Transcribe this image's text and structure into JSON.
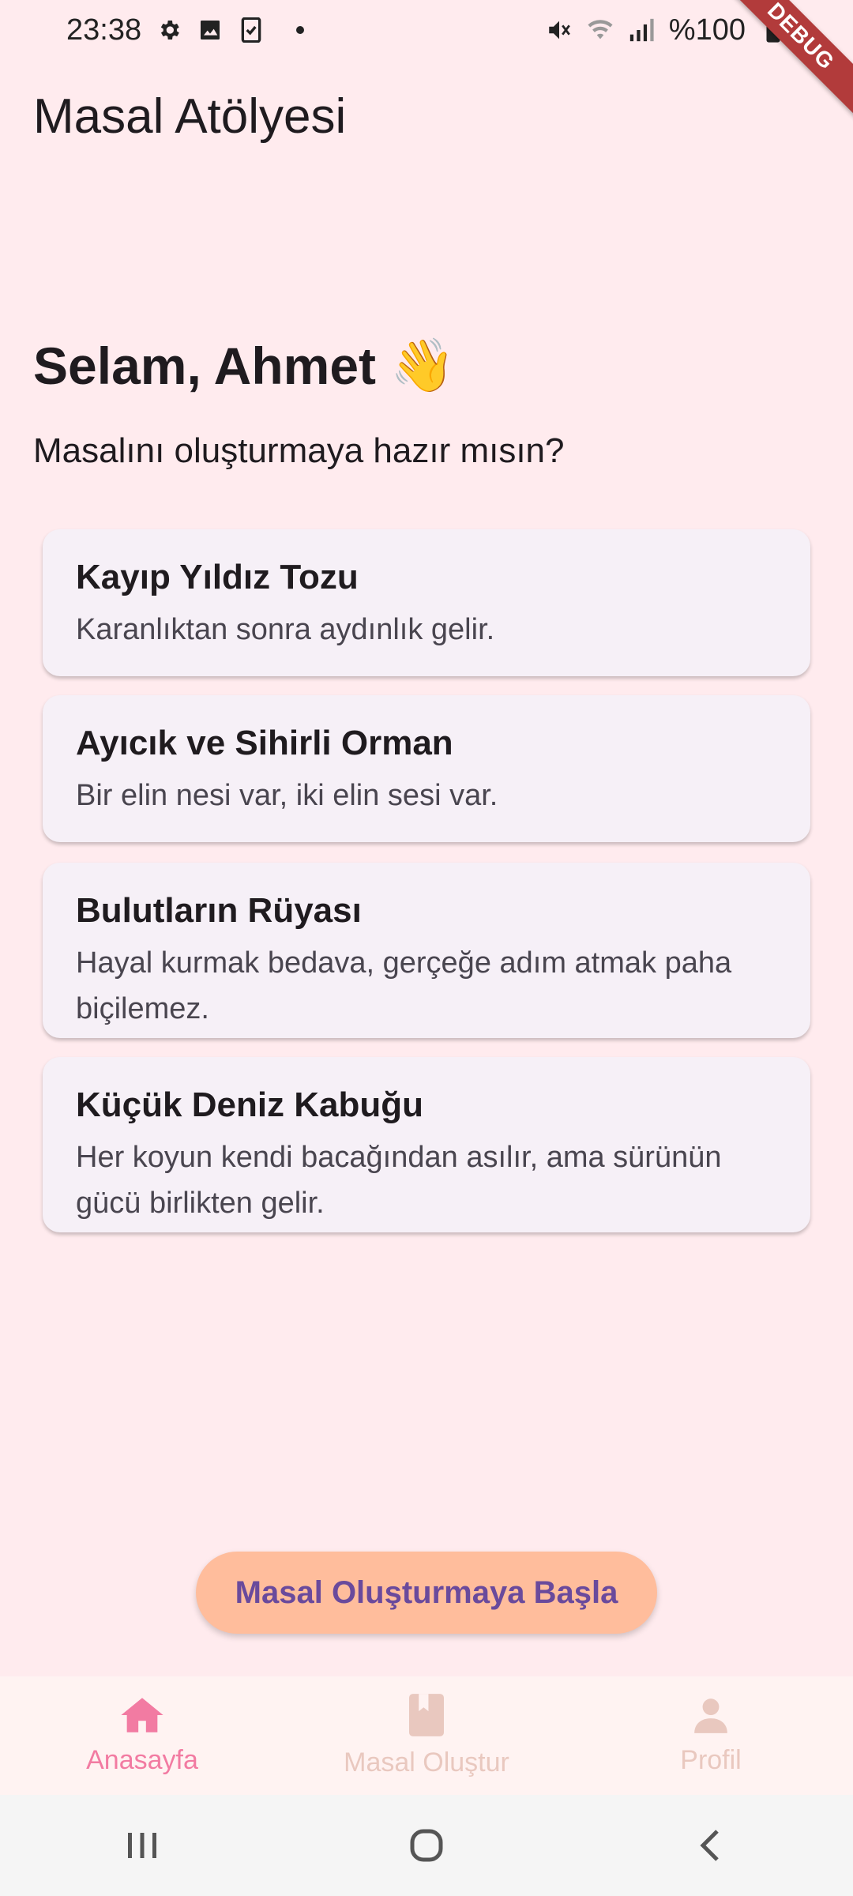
{
  "status_bar": {
    "time": "23:38",
    "battery": "%100",
    "left_icons": [
      "gear-icon",
      "image-icon",
      "clipboard-check-icon"
    ],
    "right_icons": [
      "mute-icon",
      "wifi-icon",
      "signal-icon",
      "battery-icon"
    ]
  },
  "debug_banner": "DEBUG",
  "app_bar": {
    "title": "Masal Atölyesi"
  },
  "greeting": {
    "text": "Selam, Ahmet",
    "emoji": "👋",
    "subtitle": "Masalını oluşturmaya hazır mısın?"
  },
  "stories": [
    {
      "title": "Kayıp Yıldız Tozu",
      "body": "Karanlıktan sonra aydınlık gelir."
    },
    {
      "title": "Ayıcık ve Sihirli Orman",
      "body": "Bir elin nesi var, iki elin sesi var."
    },
    {
      "title": "Bulutların Rüyası",
      "body": "Hayal kurmak bedava, gerçeğe adım atmak paha biçilemez."
    },
    {
      "title": "Küçük Deniz Kabuğu",
      "body": "Her koyun kendi bacağından asılır, ama sürünün gücü birlikten gelir."
    }
  ],
  "start_button": {
    "label": "Masal Oluşturmaya Başla"
  },
  "bottom_nav": {
    "items": [
      {
        "label": "Anasayfa",
        "icon": "home-icon",
        "active": true
      },
      {
        "label": "Masal Oluştur",
        "icon": "book-icon",
        "active": false
      },
      {
        "label": "Profil",
        "icon": "person-icon",
        "active": false
      }
    ]
  },
  "system_nav": {
    "buttons": [
      "recent-apps-icon",
      "home-circle-icon",
      "back-icon"
    ]
  },
  "colors": {
    "background": "#FFEBEE",
    "card": "#F6F0F7",
    "button": "#FFBD9C",
    "button_text": "#6A4A9C",
    "nav_active": "#F27BA2",
    "nav_inactive": "#E9C8BF"
  }
}
